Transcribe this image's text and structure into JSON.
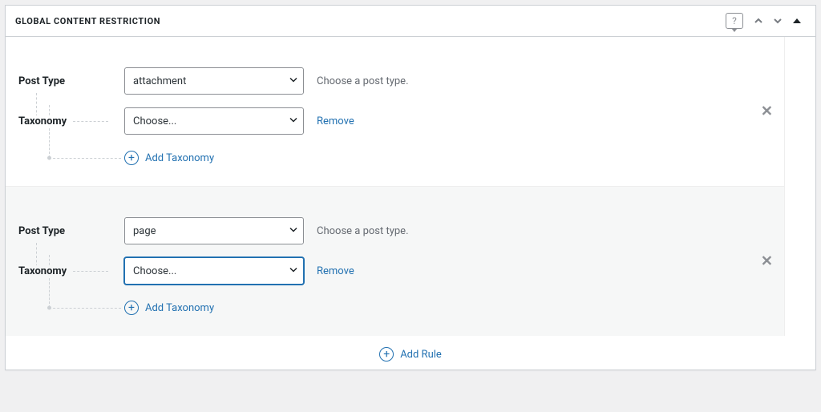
{
  "panel": {
    "title": "GLOBAL CONTENT RESTRICTION"
  },
  "labels": {
    "post_type": "Post Type",
    "taxonomy": "Taxonomy",
    "choose_post_type_hint": "Choose a post type.",
    "remove": "Remove",
    "add_taxonomy": "Add Taxonomy",
    "add_rule": "Add Rule",
    "choose_placeholder": "Choose..."
  },
  "rules": [
    {
      "post_type_value": "attachment",
      "taxonomy_value": "Choose...",
      "taxonomy_focused": false
    },
    {
      "post_type_value": "page",
      "taxonomy_value": "Choose...",
      "taxonomy_focused": true
    }
  ]
}
